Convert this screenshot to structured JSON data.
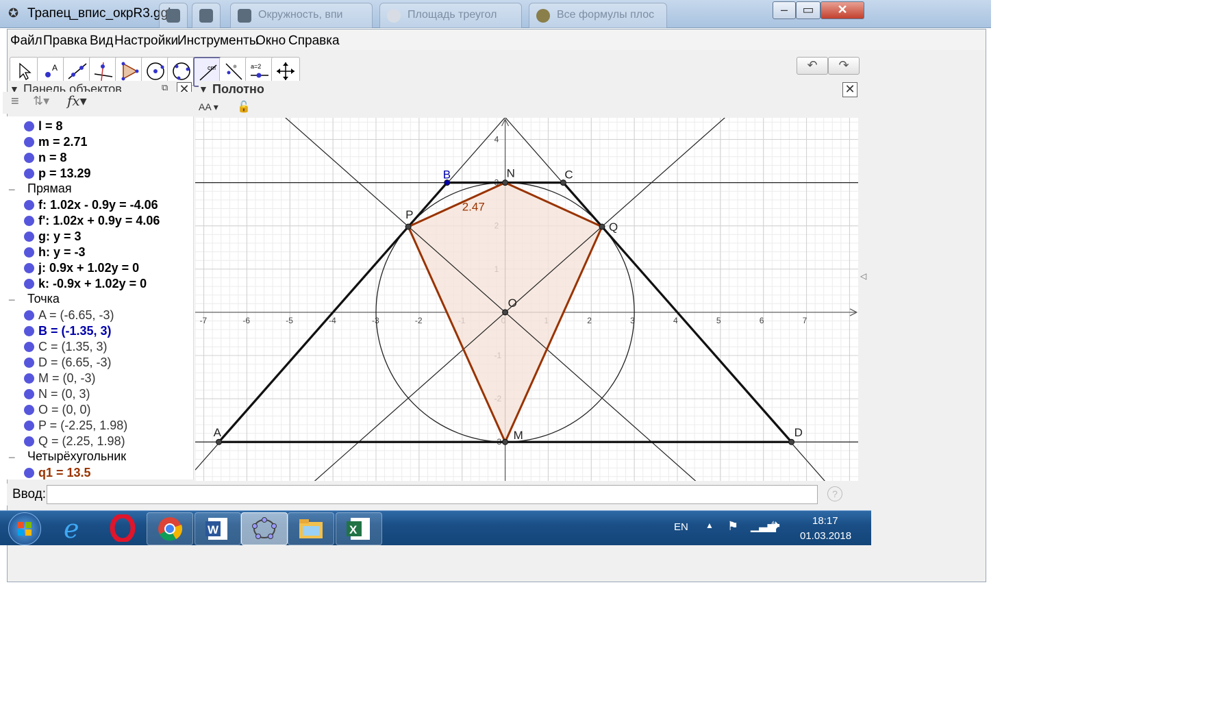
{
  "window": {
    "title": "Трапец_впис_окрR3.ggb",
    "tabs": [
      "Окружность, впи",
      "Площадь треугол",
      "Все формулы плос"
    ]
  },
  "menu": [
    "Файл",
    "Правка",
    "Вид",
    "Настройки",
    "Инструменты",
    "Окно",
    "Справка"
  ],
  "tools": [
    {
      "name": "move-tool",
      "icon": "arrow-icon"
    },
    {
      "name": "point-tool",
      "icon": "point-icon"
    },
    {
      "name": "line-tool",
      "icon": "line-icon"
    },
    {
      "name": "perpendicular-tool",
      "icon": "perpendicular-icon"
    },
    {
      "name": "polygon-tool",
      "icon": "polygon-icon"
    },
    {
      "name": "circle-tool",
      "icon": "circle-icon"
    },
    {
      "name": "circle-3pts-tool",
      "icon": "circle-3pts-icon"
    },
    {
      "name": "distance-tool",
      "icon": "distance-icon",
      "selected": true,
      "label": "cm"
    },
    {
      "name": "reflect-tool",
      "icon": "reflect-icon"
    },
    {
      "name": "slider-tool",
      "icon": "slider-icon",
      "label": "a=2"
    },
    {
      "name": "move-view-tool",
      "icon": "move-view-icon"
    }
  ],
  "algebra_panel": {
    "title": "Панель объектов",
    "rows": [
      {
        "kind": "item",
        "text": "l = 8",
        "color": "#000000"
      },
      {
        "kind": "item",
        "text": "m = 2.71",
        "color": "#000000"
      },
      {
        "kind": "item",
        "text": "n = 8",
        "color": "#000000"
      },
      {
        "kind": "item",
        "text": "p = 13.29",
        "color": "#000000"
      },
      {
        "kind": "category",
        "text": "Прямая"
      },
      {
        "kind": "item",
        "text": "f: 1.02x - 0.9y = -4.06",
        "color": "#000000"
      },
      {
        "kind": "item",
        "text": "f': 1.02x + 0.9y = 4.06",
        "color": "#000000"
      },
      {
        "kind": "item",
        "text": "g: y = 3",
        "color": "#000000"
      },
      {
        "kind": "item",
        "text": "h: y = -3",
        "color": "#000000"
      },
      {
        "kind": "item",
        "text": "j: 0.9x + 1.02y = 0",
        "color": "#000000"
      },
      {
        "kind": "item",
        "text": "k: -0.9x + 1.02y = 0",
        "color": "#000000"
      },
      {
        "kind": "category",
        "text": "Точка"
      },
      {
        "kind": "item",
        "text": "A = (-6.65, -3)",
        "color": "#333333",
        "weight": "normal"
      },
      {
        "kind": "item",
        "text": "B = (-1.35, 3)",
        "color": "#0000aa"
      },
      {
        "kind": "item",
        "text": "C = (1.35, 3)",
        "color": "#333333",
        "weight": "normal"
      },
      {
        "kind": "item",
        "text": "D = (6.65, -3)",
        "color": "#333333",
        "weight": "normal"
      },
      {
        "kind": "item",
        "text": "M = (0, -3)",
        "color": "#333333",
        "weight": "normal"
      },
      {
        "kind": "item",
        "text": "N = (0, 3)",
        "color": "#333333",
        "weight": "normal"
      },
      {
        "kind": "item",
        "text": "O = (0, 0)",
        "color": "#333333",
        "weight": "normal"
      },
      {
        "kind": "item",
        "text": "P = (-2.25, 1.98)",
        "color": "#333333",
        "weight": "normal"
      },
      {
        "kind": "item",
        "text": "Q = (2.25, 1.98)",
        "color": "#333333",
        "weight": "normal"
      },
      {
        "kind": "category",
        "text": "Четырёхугольник"
      },
      {
        "kind": "item",
        "text": "q1 = 13.5",
        "color": "#993300"
      }
    ]
  },
  "graphics": {
    "title": "Полотно",
    "xlim": [
      -7.2,
      8.2
    ],
    "ylim": [
      -3.9,
      4.5
    ],
    "x_ticks": [
      "-7",
      "-6",
      "-5",
      "-4",
      "-3",
      "-2",
      "-1",
      "0",
      "1",
      "2",
      "3",
      "4",
      "5",
      "6",
      "7"
    ],
    "y_ticks": [
      "-3",
      "-2",
      "-1",
      "1",
      "2",
      "3",
      "4"
    ],
    "points": [
      {
        "label": "A",
        "x": -6.65,
        "y": -3
      },
      {
        "label": "B",
        "x": -1.35,
        "y": 3,
        "color": "#0000aa"
      },
      {
        "label": "C",
        "x": 1.35,
        "y": 3
      },
      {
        "label": "D",
        "x": 6.65,
        "y": -3
      },
      {
        "label": "M",
        "x": 0,
        "y": -3
      },
      {
        "label": "N",
        "x": 0,
        "y": 3
      },
      {
        "label": "O",
        "x": 0,
        "y": 0
      },
      {
        "label": "P",
        "x": -2.25,
        "y": 1.98
      },
      {
        "label": "Q",
        "x": 2.25,
        "y": 1.98
      }
    ],
    "circle": {
      "cx": 0,
      "cy": 0,
      "r": 3
    },
    "lines": [
      {
        "name": "f",
        "a": 1.02,
        "b": -0.9,
        "c": -4.06
      },
      {
        "name": "f'",
        "a": 1.02,
        "b": 0.9,
        "c": 4.06
      },
      {
        "name": "g",
        "a": 0,
        "b": 1,
        "c": 3
      },
      {
        "name": "h",
        "a": 0,
        "b": 1,
        "c": -3
      },
      {
        "name": "j",
        "a": 0.9,
        "b": 1.02,
        "c": 0
      },
      {
        "name": "k",
        "a": -0.9,
        "b": 1.02,
        "c": 0
      }
    ],
    "quad_label": "2.47",
    "colors": {
      "quad": "#993300",
      "quad_fill": "#f5e3da"
    }
  },
  "input_bar": {
    "label": "Ввод:"
  },
  "taskbar": {
    "lang": "EN",
    "time": "18:17",
    "date": "01.03.2018"
  }
}
